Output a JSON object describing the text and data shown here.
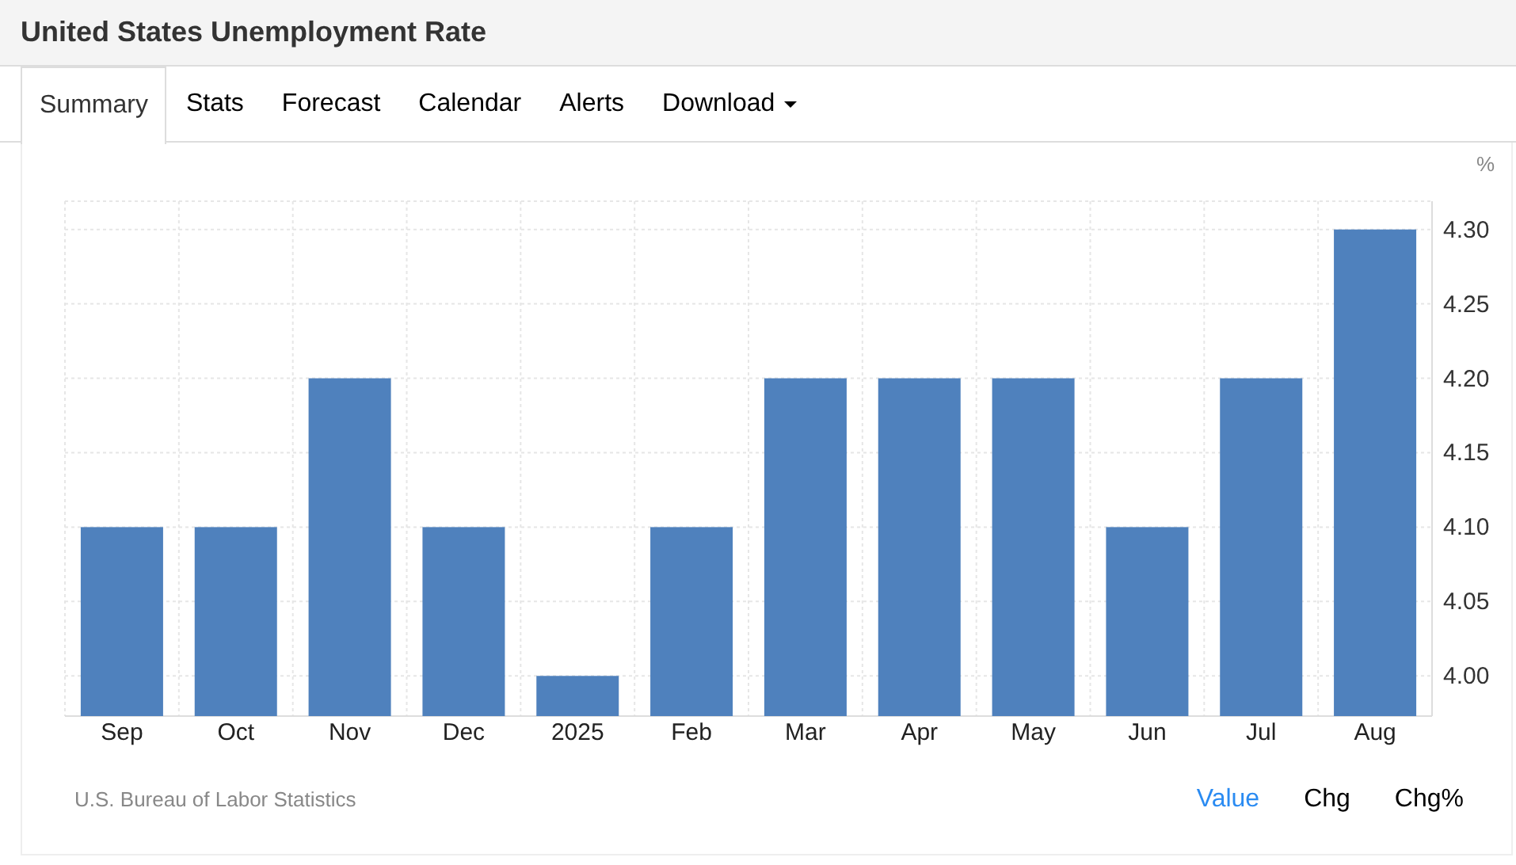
{
  "header": {
    "title": "United States Unemployment Rate"
  },
  "tabs": [
    {
      "label": "Summary",
      "selected": true,
      "dropdown": false
    },
    {
      "label": "Stats",
      "selected": false,
      "dropdown": false
    },
    {
      "label": "Forecast",
      "selected": false,
      "dropdown": false
    },
    {
      "label": "Calendar",
      "selected": false,
      "dropdown": false
    },
    {
      "label": "Alerts",
      "selected": false,
      "dropdown": false
    },
    {
      "label": "Download",
      "selected": false,
      "dropdown": true
    }
  ],
  "chart": {
    "unit": "%",
    "chart_data": {
      "type": "bar",
      "categories": [
        "Sep",
        "Oct",
        "Nov",
        "Dec",
        "2025",
        "Feb",
        "Mar",
        "Apr",
        "May",
        "Jun",
        "Jul",
        "Aug"
      ],
      "grid": true,
      "series": [
        {
          "color": "#4f81bd",
          "values": [
            4.1,
            4.1,
            4.2,
            4.1,
            4.0,
            4.1,
            4.2,
            4.2,
            4.2,
            4.1,
            4.2,
            4.3
          ]
        }
      ],
      "ylim": [
        3.973,
        4.319
      ],
      "yticks": [
        {
          "value": 4.0,
          "label": "4.00"
        },
        {
          "value": 4.05,
          "label": "4.05"
        },
        {
          "value": 4.1,
          "label": "4.10"
        },
        {
          "value": 4.15,
          "label": "4.15"
        },
        {
          "value": 4.2,
          "label": "4.20"
        },
        {
          "value": 4.25,
          "label": "4.25"
        },
        {
          "value": 4.3,
          "label": "4.30"
        }
      ]
    }
  },
  "source": "U.S. Bureau of Labor Statistics",
  "views": [
    {
      "label": "Value",
      "selected": true
    },
    {
      "label": "Chg",
      "selected": false
    },
    {
      "label": "Chg%",
      "selected": false
    }
  ]
}
